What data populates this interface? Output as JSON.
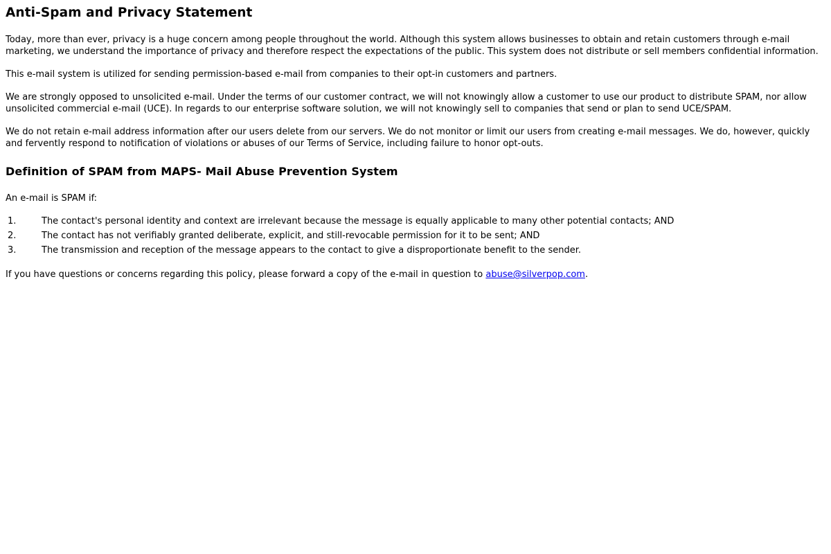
{
  "page": {
    "title": "Anti-Spam and Privacy Statement",
    "paragraphs": [
      "Today, more than ever, privacy is a huge concern among people throughout the world. Although this system allows businesses to obtain and retain customers through e-mail marketing, we understand the importance of privacy and therefore respect the expectations of the public. This system does not distribute or sell members confidential information.",
      "This e-mail system is utilized for sending permission-based e-mail from companies to their opt-in customers and partners.",
      "We are strongly opposed to unsolicited e-mail. Under the terms of our customer contract, we will not knowingly allow a customer to use our product to distribute SPAM, nor allow unsolicited commercial e-mail (UCE). In regards to our enterprise software solution, we will not knowingly sell to companies that send or plan to send UCE/SPAM.",
      "We do not retain e-mail address information after our users delete from our servers. We do not monitor or limit our users from creating e-mail messages. We do, however, quickly and fervently respond to notification of violations or abuses of our Terms of Service, including failure to honor opt-outs."
    ],
    "definition_title": "Definition of SPAM from MAPS- Mail Abuse Prevention System",
    "definition_intro": "An e-mail is SPAM if:",
    "rules": [
      {
        "num": "1.",
        "text": "The contact's personal identity and context are irrelevant because the message is equally applicable to many other potential contacts; AND"
      },
      {
        "num": "2.",
        "text": "The contact has not verifiably granted deliberate, explicit, and still-revocable permission for it to be sent; AND"
      },
      {
        "num": "3.",
        "text": "The transmission and reception of the message appears to the contact to give a disproportionate benefit to the sender."
      }
    ],
    "closing": {
      "text": "If you have questions or concerns regarding this policy, please forward a copy of the e-mail in question to ",
      "link_text": "abuse@silverpop.com",
      "link_href": "mailto:abuse@silverpop.com",
      "suffix": "."
    }
  }
}
